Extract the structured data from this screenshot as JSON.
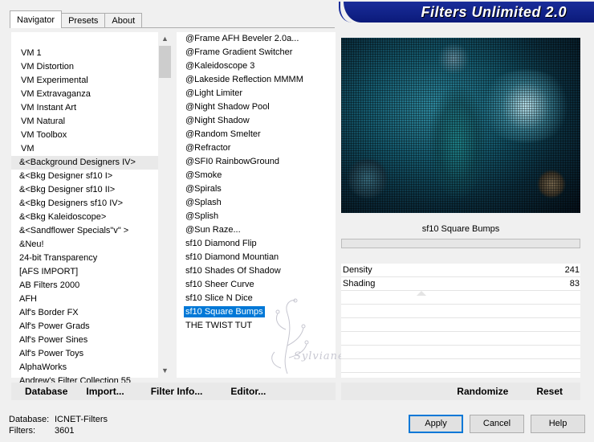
{
  "banner_title": "Filters Unlimited 2.0",
  "tabs": [
    {
      "label": "Navigator",
      "active": true
    },
    {
      "label": "Presets",
      "active": false
    },
    {
      "label": "About",
      "active": false
    }
  ],
  "navigator": {
    "items": [
      "VM 1",
      "VM Distortion",
      "VM Experimental",
      "VM Extravaganza",
      "VM Instant Art",
      "VM Natural",
      "VM Toolbox",
      "VM",
      "&<Background Designers IV>",
      "&<Bkg Designer sf10 I>",
      "&<Bkg Designer sf10 II>",
      "&<Bkg Designers sf10 IV>",
      "&<Bkg Kaleidoscope>",
      "&<Sandflower Specials\"v\" >",
      "&Neu!",
      "24-bit Transparency",
      "[AFS IMPORT]",
      "AB Filters 2000",
      "AFH",
      "Alf's Border FX",
      "Alf's Power Grads",
      "Alf's Power Sines",
      "Alf's Power Toys",
      "AlphaWorks",
      "Andrew's Filter Collection 55"
    ],
    "selected_index": 8
  },
  "filters": {
    "items": [
      "@Frame AFH Beveler 2.0a...",
      "@Frame Gradient Switcher",
      "@Kaleidoscope 3",
      "@Lakeside Reflection MMMM",
      "@Light Limiter",
      "@Night Shadow Pool",
      "@Night Shadow",
      "@Random Smelter",
      "@Refractor",
      "@SFI0 RainbowGround",
      "@Smoke",
      "@Spirals",
      "@Splash",
      "@Splish",
      "@Sun Raze...",
      "sf10 Diamond Flip",
      "sf10 Diamond Mountian",
      "sf10 Shades Of Shadow",
      "sf10 Sheer Curve",
      "sf10 Slice N Dice",
      "sf10 Square Bumps",
      "THE TWIST TUT"
    ],
    "selected_index": 20
  },
  "watermark_text": "Sylviane",
  "preview": {
    "filter_name": "sf10 Square Bumps"
  },
  "params": [
    {
      "name": "Density",
      "value": "241"
    },
    {
      "name": "Shading",
      "value": "83"
    }
  ],
  "toolbar": {
    "database": "Database",
    "import": "Import...",
    "filter_info": "Filter Info...",
    "editor": "Editor...",
    "randomize": "Randomize",
    "reset": "Reset"
  },
  "status": {
    "database_label": "Database:",
    "database_value": "ICNET-Filters",
    "filters_label": "Filters:",
    "filters_value": "3601"
  },
  "buttons": {
    "apply": "Apply",
    "cancel": "Cancel",
    "help": "Help"
  },
  "colors": {
    "banner": "#0b1a7a",
    "selection": "#0078d7"
  }
}
